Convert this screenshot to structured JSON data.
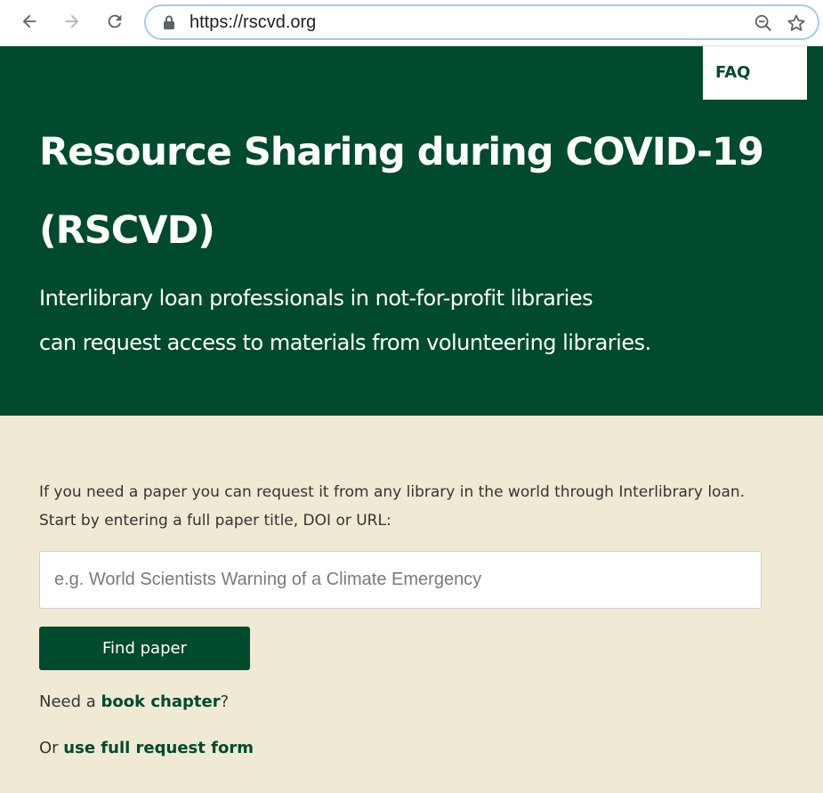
{
  "browser": {
    "url": "https://rscvd.org"
  },
  "nav": {
    "faq_label": "FAQ"
  },
  "hero": {
    "title": "Resource Sharing during COVID-19 (RSCVD)",
    "subtitle_line1": "Interlibrary loan professionals in not-for-profit libraries",
    "subtitle_line2": "can request access to materials from volunteering libraries."
  },
  "main": {
    "intro_line1": "If you need a paper you can request it from any library in the world through Interlibrary loan.",
    "intro_line2": "Start by entering a full paper title, DOI or URL:",
    "search_placeholder": "e.g. World Scientists Warning of a Climate Emergency",
    "search_value": "",
    "find_button": "Find paper",
    "book_prefix": "Need a ",
    "book_link": "book chapter",
    "book_suffix": "?",
    "full_prefix": "Or ",
    "full_link": "use full request form"
  },
  "colors": {
    "brand_green": "#004a2d",
    "page_background": "#f0ead4"
  }
}
